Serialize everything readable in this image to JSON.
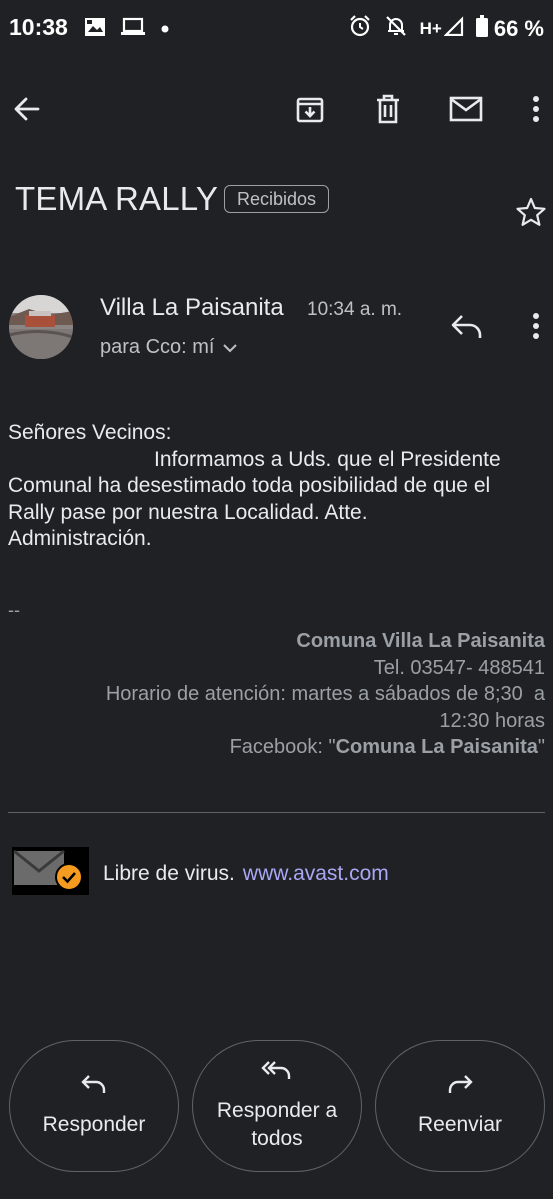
{
  "status_bar": {
    "time": "10:38",
    "network": "H+",
    "battery": "66 %"
  },
  "toolbar": {
    "icons": [
      "back-arrow-icon",
      "archive-icon",
      "delete-icon",
      "mark-unread-icon",
      "more-vert-icon"
    ]
  },
  "email": {
    "subject": "TEMA RALLY",
    "label": "Recibidos",
    "sender": "Villa La Paisanita",
    "time": "10:34 a. m.",
    "recipient": "para Cco: mí",
    "body": {
      "greeting": "Señores Vecinos:",
      "line1": "Informamos a Uds. que el Presidente",
      "line2": "Comunal ha desestimado toda posibilidad de que el",
      "line3": "Rally pase por nuestra Localidad. Atte.",
      "line4": "Administración."
    },
    "signature": {
      "separator": "--",
      "org": "Comuna Villa La Paisanita",
      "phone": "Tel. 03547- 488541",
      "hours_line1": "Horario de atención: martes a sábados de 8;30  a",
      "hours_line2": "12:30 horas",
      "facebook_prefix": "Facebook: \"",
      "facebook_name": "Comuna La Paisanita",
      "facebook_suffix": "\""
    },
    "virus": {
      "text": "Libre de virus.",
      "link": "www.avast.com"
    }
  },
  "actions": {
    "reply": "Responder",
    "reply_all_line1": "Responder a",
    "reply_all_line2": "todos",
    "forward": "Reenviar"
  },
  "colors": {
    "background": "#202124",
    "link": "#a9a7f5",
    "badge": "#f59b1f"
  }
}
